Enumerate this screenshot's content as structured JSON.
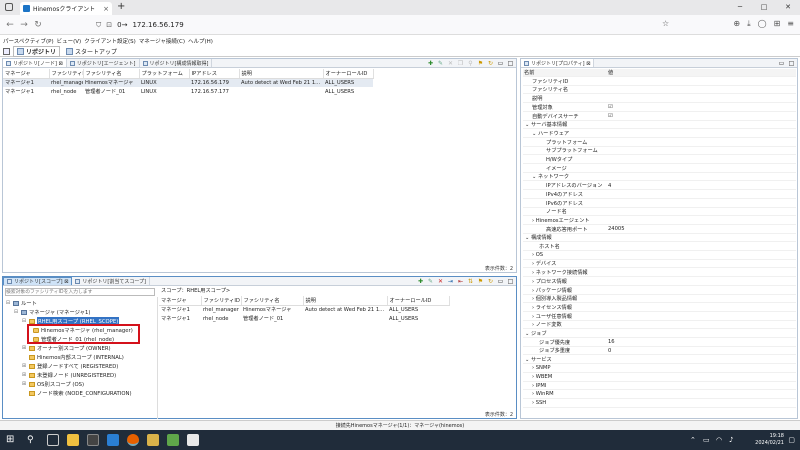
{
  "browser": {
    "tab_title": "Hinemosクライアント",
    "tab_close": "×",
    "new_tab": "+",
    "url_prefix": "0→",
    "url": "172.16.56.179",
    "window_controls": [
      "─",
      "□",
      "✕"
    ]
  },
  "menubar": [
    "パースペクティブ(P)",
    "ビュー(V)",
    "クライアント設定(S)",
    "マネージャ接続(C)",
    "ヘルプ(H)"
  ],
  "perspectives": [
    {
      "label": "リポジトリ",
      "active": true
    },
    {
      "label": "スタートアップ",
      "active": false
    }
  ],
  "top_pane": {
    "tabs": [
      "リポジトリ[ノード] ⊠",
      "リポジトリ[エージェント]",
      "リポジトリ[構成情報取得]"
    ],
    "columns": [
      "マネージャ",
      "ファシリティID",
      "ファシリティ名",
      "プラットフォーム",
      "IPアドレス",
      "説明",
      "オーナーロールID"
    ],
    "rows": [
      [
        "マネージャ1",
        "rhel_manager",
        "Hinemosマネージャ",
        "LINUX",
        "172.16.56.179",
        "Auto detect at Wed Feb 21 1...",
        "ALL_USERS"
      ],
      [
        "マネージャ1",
        "rhel_node",
        "管理者ノード_01",
        "LINUX",
        "172.16.57.177",
        "",
        "ALL_USERS"
      ]
    ],
    "count_label": "表示件数：2"
  },
  "bottom_pane": {
    "tabs": [
      "リポジトリ[スコープ] ⊠",
      "リポジトリ[割当てスコープ]"
    ],
    "search_placeholder": "検索対象のファシリティIDを入力します",
    "scope_path": "スコープ：RHEL用スコープ>",
    "tree": [
      {
        "label": "ルート",
        "level": 0,
        "icon": "root",
        "toggle": "⊟"
      },
      {
        "label": "マネージャ (マネージャ1)",
        "level": 1,
        "icon": "root",
        "toggle": "⊟"
      },
      {
        "label": "RHEL用スコープ (RHEL_SCOPE)",
        "level": 2,
        "icon": "scope",
        "toggle": "⊟",
        "selected": true
      },
      {
        "label": "Hinemosマネージャ (rhel_manager)",
        "level": 3,
        "icon": "node",
        "toggle": ""
      },
      {
        "label": "管理者ノード_01 (rhel_node)",
        "level": 3,
        "icon": "node",
        "toggle": ""
      },
      {
        "label": "オーナー別スコープ (OWNER)",
        "level": 2,
        "icon": "scope",
        "toggle": "⊞"
      },
      {
        "label": "Hinemos内部スコープ (INTERNAL)",
        "level": 2,
        "icon": "scope",
        "toggle": ""
      },
      {
        "label": "登録ノードすべて (REGISTERED)",
        "level": 2,
        "icon": "scope",
        "toggle": "⊞"
      },
      {
        "label": "未登録ノード (UNREGISTERED)",
        "level": 2,
        "icon": "scope",
        "toggle": "⊞"
      },
      {
        "label": "OS別スコープ (OS)",
        "level": 2,
        "icon": "scope",
        "toggle": "⊞"
      },
      {
        "label": "ノード検索 (NODE_CONFIGURATION)",
        "level": 2,
        "icon": "scope",
        "toggle": ""
      }
    ],
    "columns": [
      "マネージャ",
      "ファシリティID",
      "ファシリティ名",
      "説明",
      "オーナーロールID"
    ],
    "rows": [
      [
        "マネージャ1",
        "rhel_manager",
        "Hinemosマネージャ",
        "Auto detect at Wed Feb 21 1...",
        "ALL_USERS"
      ],
      [
        "マネージャ1",
        "rhel_node",
        "管理者ノード_01",
        "",
        "ALL_USERS"
      ]
    ],
    "count_label": "表示件数：2"
  },
  "property_pane": {
    "tab": "リポジトリ[プロパティ] ⊠",
    "columns": [
      "名前",
      "値"
    ],
    "rows": [
      {
        "name": "ファシリティID",
        "value": "",
        "indent": 1
      },
      {
        "name": "ファシリティ名",
        "value": "",
        "indent": 1
      },
      {
        "name": "説明",
        "value": "",
        "indent": 1
      },
      {
        "name": "管理対象",
        "value": "☑",
        "indent": 1
      },
      {
        "name": "自動デバイスサーチ",
        "value": "☑",
        "indent": 1
      },
      {
        "name": "⌄ サーバ基本情報",
        "value": "",
        "indent": 0
      },
      {
        "name": "⌄ ハードウェア",
        "value": "",
        "indent": 1
      },
      {
        "name": "プラットフォーム",
        "value": "",
        "indent": 3
      },
      {
        "name": "サブプラットフォーム",
        "value": "",
        "indent": 3
      },
      {
        "name": "H/Wタイプ",
        "value": "",
        "indent": 3
      },
      {
        "name": "イメージ",
        "value": "",
        "indent": 3
      },
      {
        "name": "⌄ ネットワーク",
        "value": "",
        "indent": 1
      },
      {
        "name": "IPアドレスのバージョン",
        "value": "4",
        "indent": 3
      },
      {
        "name": "IPv4のアドレス",
        "value": "",
        "indent": 3
      },
      {
        "name": "IPv6のアドレス",
        "value": "",
        "indent": 3
      },
      {
        "name": "ノード名",
        "value": "",
        "indent": 3
      },
      {
        "name": "› Hinemosエージェント",
        "value": "",
        "indent": 1
      },
      {
        "name": "高速応答用ポート",
        "value": "24005",
        "indent": 3
      },
      {
        "name": "⌄ 構成情報",
        "value": "",
        "indent": 0
      },
      {
        "name": "ホスト名",
        "value": "",
        "indent": 2
      },
      {
        "name": "› OS",
        "value": "",
        "indent": 1
      },
      {
        "name": "› デバイス",
        "value": "",
        "indent": 1
      },
      {
        "name": "› ネットワーク接続情報",
        "value": "",
        "indent": 1
      },
      {
        "name": "› プロセス情報",
        "value": "",
        "indent": 1
      },
      {
        "name": "› パッケージ情報",
        "value": "",
        "indent": 1
      },
      {
        "name": "› 個別導入製品情報",
        "value": "",
        "indent": 1
      },
      {
        "name": "› ライセンス情報",
        "value": "",
        "indent": 1
      },
      {
        "name": "› ユーザ任意情報",
        "value": "",
        "indent": 1
      },
      {
        "name": "› ノード変数",
        "value": "",
        "indent": 1
      },
      {
        "name": "⌄ ジョブ",
        "value": "",
        "indent": 0
      },
      {
        "name": "ジョブ優先度",
        "value": "16",
        "indent": 2
      },
      {
        "name": "ジョブ多重度",
        "value": "0",
        "indent": 2
      },
      {
        "name": "⌄ サービス",
        "value": "",
        "indent": 0
      },
      {
        "name": "› SNMP",
        "value": "",
        "indent": 1
      },
      {
        "name": "› WBEM",
        "value": "",
        "indent": 1
      },
      {
        "name": "› IPMI",
        "value": "",
        "indent": 1
      },
      {
        "name": "› WinRM",
        "value": "",
        "indent": 1
      },
      {
        "name": "› SSH",
        "value": "",
        "indent": 1
      }
    ]
  },
  "statusbar": "接続先Hinemosマネージャ(1/1)：マネージャ(hinemos)",
  "taskbar": {
    "time": "19:18",
    "date": "2024/02/21"
  }
}
